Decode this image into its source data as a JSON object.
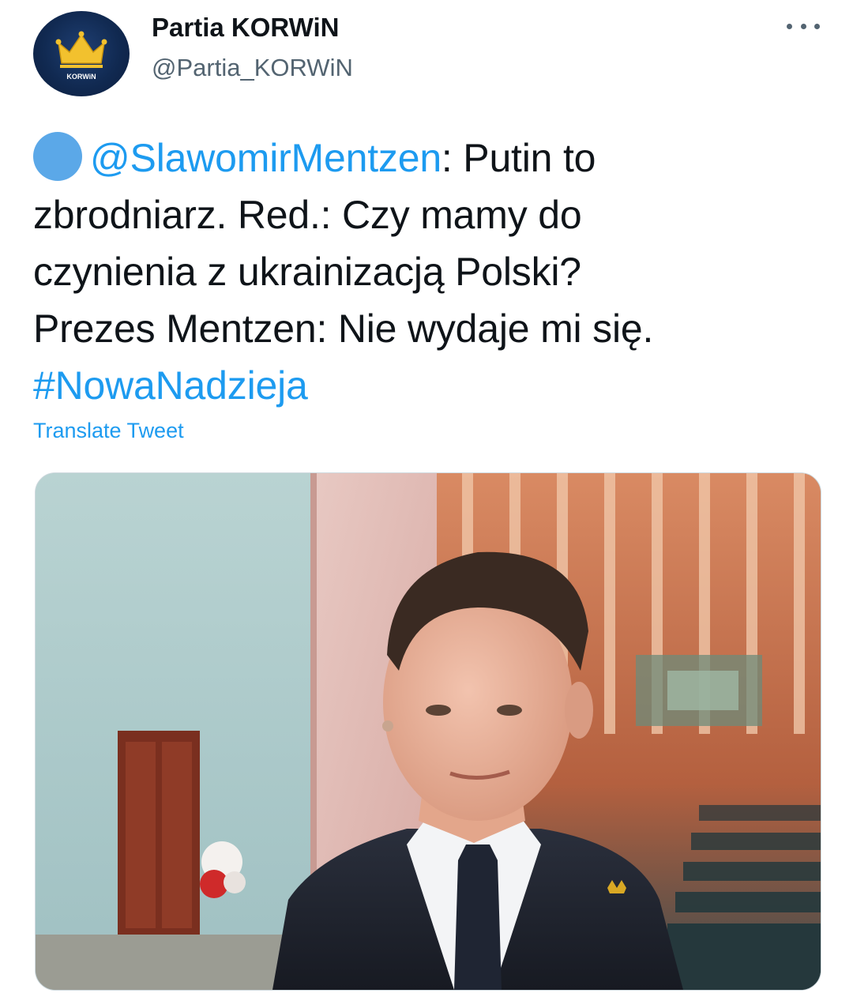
{
  "tweet": {
    "avatar": {
      "icon": "crown-icon",
      "logo_text": "KORWiN"
    },
    "display_name": "Partia KORWiN",
    "handle": "@Partia_KORWiN",
    "more_icon": "more-horizontal-icon",
    "text": {
      "mention": "@SlawomirMentzen",
      "line1_rest": ": Putin to",
      "line2": "zbrodniarz. Red.: Czy mamy do",
      "line3": "czynienia z ukrainizacją Polski?",
      "line4": "Prezes Mentzen: Nie wydaje mi się.",
      "hashtag": "#NowaNadzieja"
    },
    "translate_label": "Translate Tweet",
    "media": {
      "kind": "photo"
    }
  },
  "colors": {
    "link": "#1d9bf0",
    "text": "#0f1419",
    "secondary": "#536471",
    "emoji_dot": "#5ba8e8",
    "avatar_bg": "#112a52",
    "crown": "#f2c12e"
  }
}
